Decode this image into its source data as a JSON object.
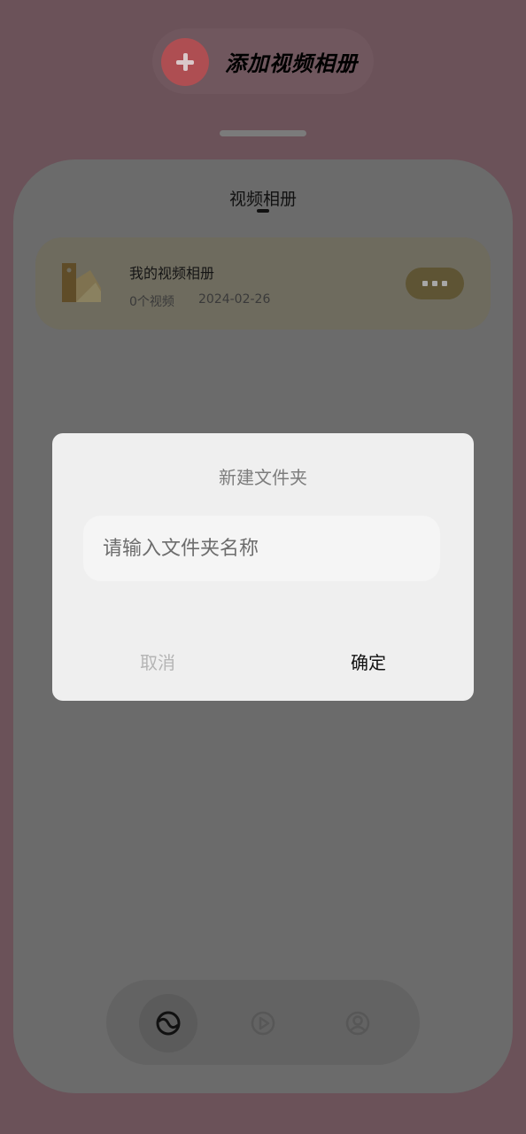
{
  "header": {
    "add_button_label": "添加视频相册"
  },
  "screen": {
    "title": "视频相册"
  },
  "albums": [
    {
      "name": "我的视频相册",
      "count": "0个视频",
      "date": "2024-02-26"
    }
  ],
  "dialog": {
    "title": "新建文件夹",
    "input_placeholder": "请输入文件夹名称",
    "input_value": "",
    "cancel_label": "取消",
    "confirm_label": "确定"
  },
  "nav": {
    "items": [
      {
        "icon": "album-icon",
        "active": true
      },
      {
        "icon": "play-icon",
        "active": false
      },
      {
        "icon": "profile-icon",
        "active": false
      }
    ]
  },
  "colors": {
    "background": "#6b5259",
    "add_accent": "#ae4e52",
    "dialog_bg": "#efefef"
  }
}
